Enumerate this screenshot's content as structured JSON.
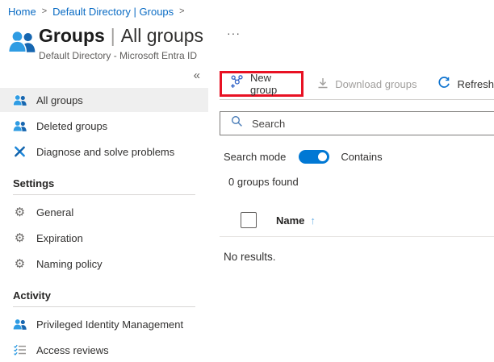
{
  "breadcrumb": {
    "home": "Home",
    "sep": ">",
    "current": "Default Directory | Groups"
  },
  "header": {
    "title": "Groups",
    "separator": "|",
    "section": "All groups",
    "more": "···",
    "subtitle": "Default Directory - Microsoft Entra ID"
  },
  "sidebar": {
    "collapse": "«",
    "nav": [
      {
        "icon": "people-icon",
        "label": "All groups",
        "selected": true
      },
      {
        "icon": "people-icon",
        "label": "Deleted groups",
        "selected": false
      },
      {
        "icon": "tools-icon",
        "label": "Diagnose and solve problems",
        "selected": false
      }
    ],
    "sections": [
      {
        "title": "Settings",
        "items": [
          {
            "icon": "gear-icon",
            "label": "General"
          },
          {
            "icon": "gear-icon",
            "label": "Expiration"
          },
          {
            "icon": "gear-icon",
            "label": "Naming policy"
          }
        ]
      },
      {
        "title": "Activity",
        "items": [
          {
            "icon": "people-icon",
            "label": "Privileged Identity Management"
          },
          {
            "icon": "checklist-icon",
            "label": "Access reviews"
          }
        ]
      }
    ]
  },
  "toolbar": {
    "new_group": "New group",
    "download": "Download groups",
    "refresh": "Refresh"
  },
  "search": {
    "placeholder": "Search"
  },
  "search_mode": {
    "label": "Search mode",
    "value": "Contains",
    "enabled": true
  },
  "results": {
    "count": "0 groups found",
    "empty": "No results."
  },
  "table": {
    "name_column": "Name",
    "sort_arrow": "↑"
  },
  "colors": {
    "accent": "#0078d4",
    "callout_red": "#e81123",
    "link_blue": "#0b6cc4",
    "disabled": "#a19f9d"
  }
}
